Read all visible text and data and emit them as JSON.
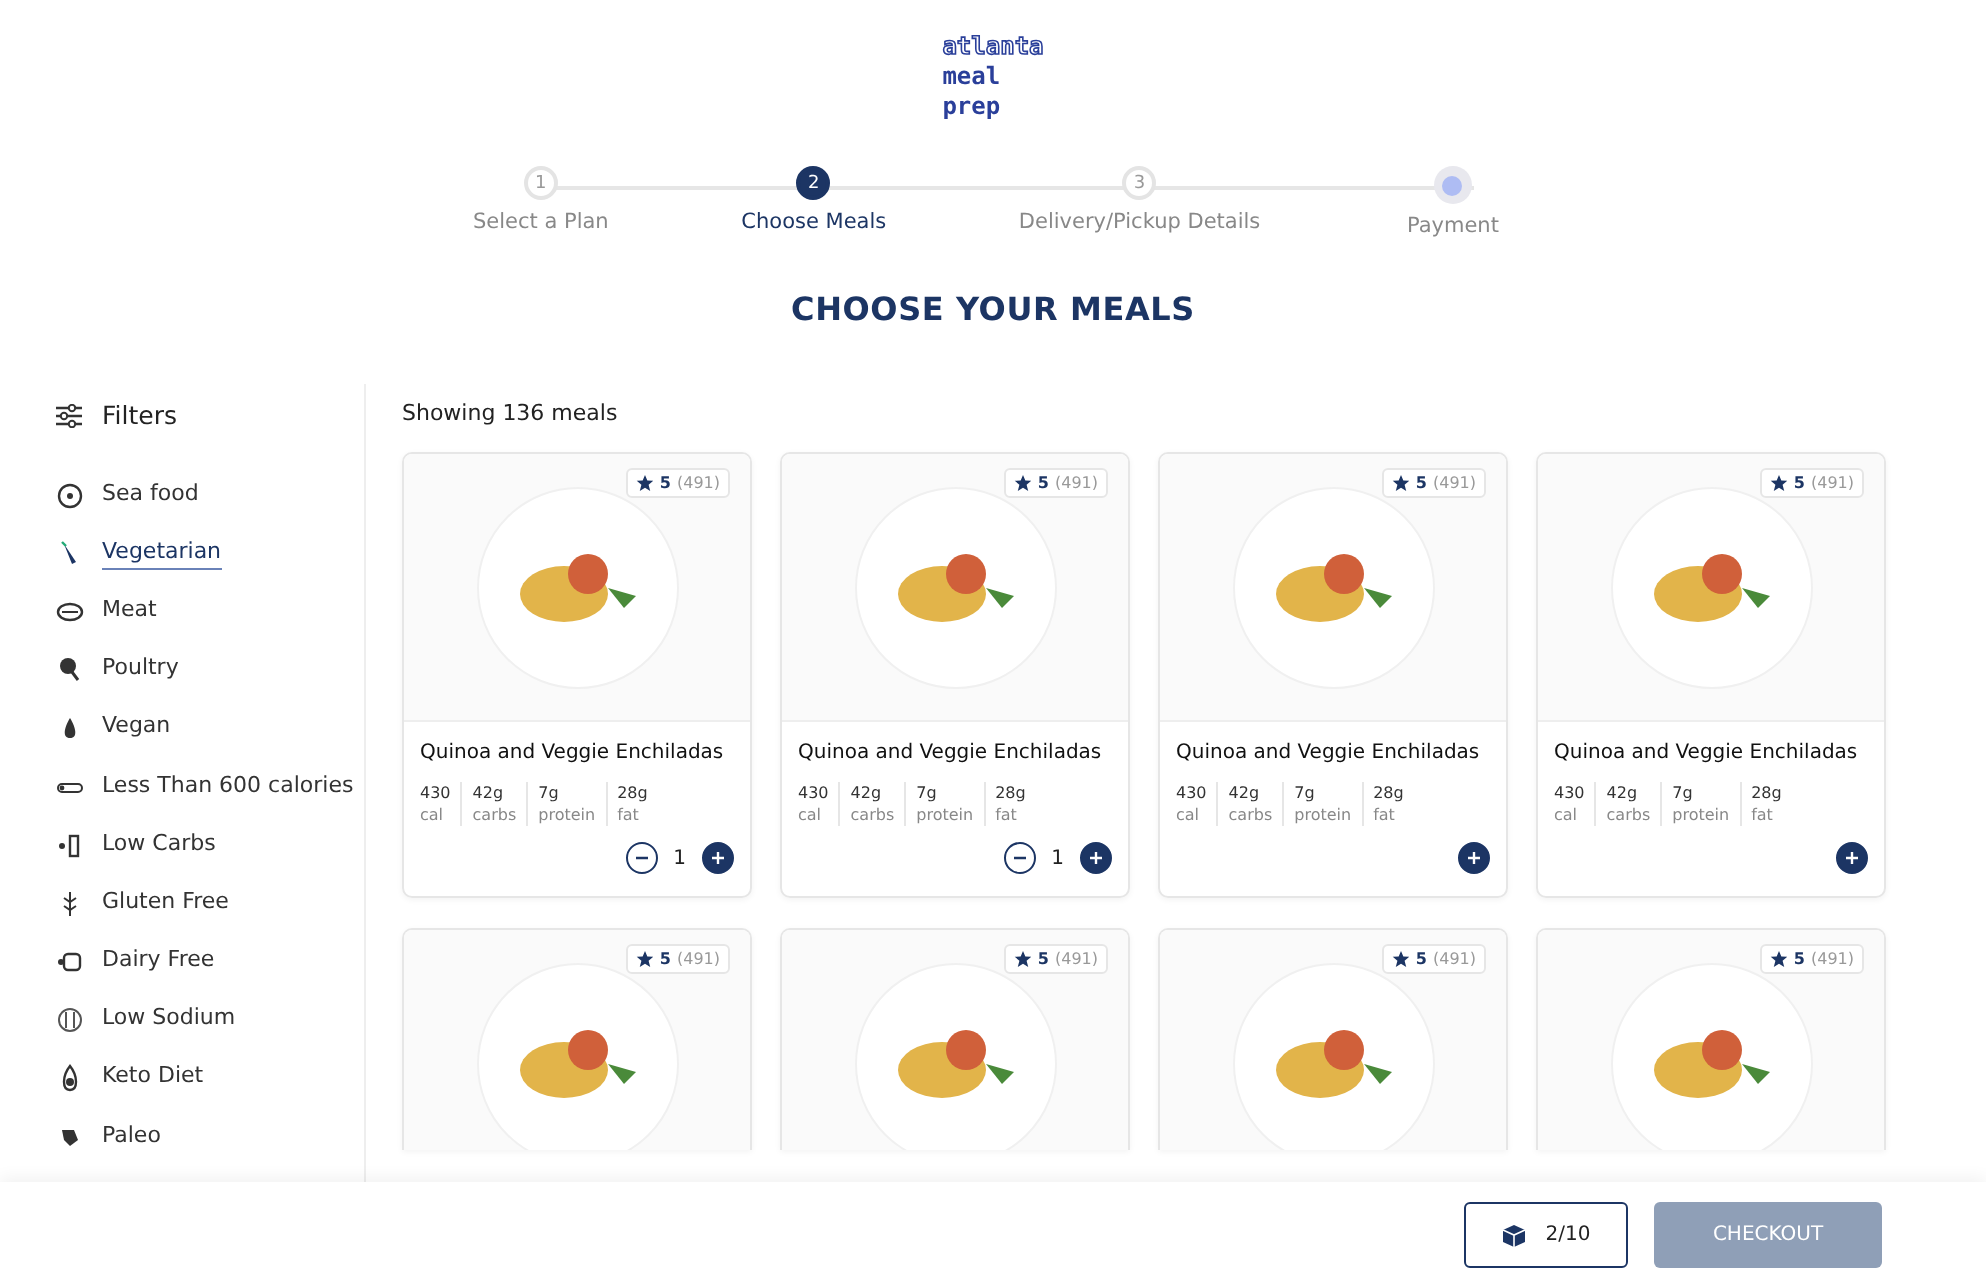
{
  "logo": {
    "lines": [
      "atlanta",
      "meal",
      "prep"
    ]
  },
  "steps": [
    {
      "number": "1",
      "label": "Select a Plan",
      "selected": false
    },
    {
      "number": "2",
      "label": "Choose Meals",
      "selected": true
    },
    {
      "number": "3",
      "label": "Delivery/Pickup Details",
      "selected": false
    },
    {
      "label": "Payment",
      "selected": false
    }
  ],
  "title": "CHOOSE YOUR MEALS",
  "filters": {
    "heading": "Filters",
    "items": [
      {
        "label": "Sea food",
        "selected": false
      },
      {
        "label": "Vegetarian",
        "selected": true
      },
      {
        "label": "Meat",
        "selected": false
      },
      {
        "label": "Poultry",
        "selected": false
      },
      {
        "label": "Vegan",
        "selected": false
      },
      {
        "label": "Less Than 600 calories",
        "selected": false
      },
      {
        "label": "Low Carbs",
        "selected": false
      },
      {
        "label": "Gluten Free",
        "selected": false
      },
      {
        "label": "Dairy Free",
        "selected": false
      },
      {
        "label": "Low Sodium",
        "selected": false
      },
      {
        "label": "Keto Diet",
        "selected": false
      },
      {
        "label": "Paleo",
        "selected": false
      }
    ]
  },
  "results": "Showing 136 meals",
  "meals": [
    {
      "rating": "5",
      "count": "(491)",
      "name": "Quinoa and Veggie Enchiladas",
      "nutrition": [
        {
          "value": "430",
          "unit": "cal"
        },
        {
          "value": "42g",
          "unit": "carbs"
        },
        {
          "value": "7g",
          "unit": "protein"
        },
        {
          "value": "28g",
          "unit": "fat"
        }
      ],
      "quantity": "1"
    },
    {
      "rating": "5",
      "count": "(491)",
      "name": "Quinoa and Veggie Enchiladas",
      "nutrition": [
        {
          "value": "430",
          "unit": "cal"
        },
        {
          "value": "42g",
          "unit": "carbs"
        },
        {
          "value": "7g",
          "unit": "protein"
        },
        {
          "value": "28g",
          "unit": "fat"
        }
      ],
      "quantity": "1"
    },
    {
      "rating": "5",
      "count": "(491)",
      "name": "Quinoa and Veggie Enchiladas",
      "nutrition": [
        {
          "value": "430",
          "unit": "cal"
        },
        {
          "value": "42g",
          "unit": "carbs"
        },
        {
          "value": "7g",
          "unit": "protein"
        },
        {
          "value": "28g",
          "unit": "fat"
        }
      ]
    },
    {
      "rating": "5",
      "count": "(491)",
      "name": "Quinoa and Veggie Enchiladas",
      "nutrition": [
        {
          "value": "430",
          "unit": "cal"
        },
        {
          "value": "42g",
          "unit": "carbs"
        },
        {
          "value": "7g",
          "unit": "protein"
        },
        {
          "value": "28g",
          "unit": "fat"
        }
      ]
    },
    {
      "rating": "5",
      "count": "(491)"
    },
    {
      "rating": "5",
      "count": "(491)"
    },
    {
      "rating": "5",
      "count": "(491)"
    },
    {
      "rating": "5",
      "count": "(491)"
    }
  ],
  "footer": {
    "box": "2/10",
    "checkout": {
      "label": "CHECKOUT",
      "disabled": true
    }
  }
}
